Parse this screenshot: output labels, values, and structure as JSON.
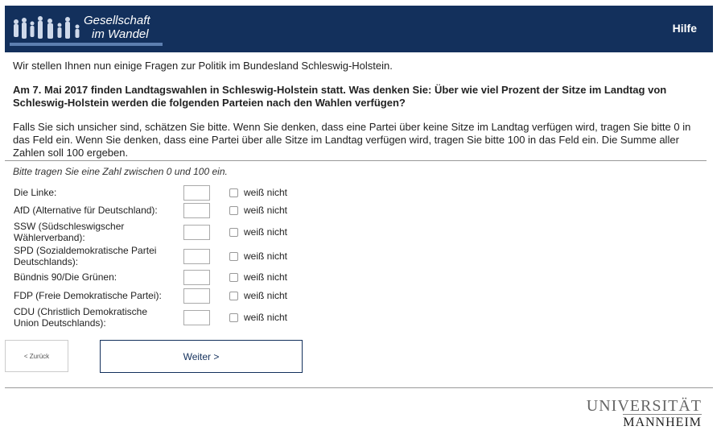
{
  "header": {
    "logo_line1": "Gesellschaft",
    "logo_line2": "im Wandel",
    "help_label": "Hilfe"
  },
  "intro": "Wir stellen Ihnen nun einige Fragen zur Politik im Bundesland Schleswig-Holstein.",
  "question": "Am 7. Mai 2017 finden Landtagswahlen in Schleswig-Holstein statt. Was denken Sie: Über wie viel Prozent der Sitze im Landtag von Schleswig-Holstein werden die folgenden Parteien nach den Wahlen verfügen?",
  "instructions": "Falls Sie sich unsicher sind, schätzen Sie bitte. Wenn Sie denken, dass eine Partei über keine Sitze im Landtag verfügen wird, tragen Sie bitte 0 in das Feld ein. Wenn Sie denken, dass eine Partei über alle Sitze im Landtag verfügen wird, tragen Sie bitte 100 in das Feld ein. Die Summe aller Zahlen soll 100 ergeben.",
  "hint": "Bitte tragen Sie eine Zahl zwischen 0 und 100 ein.",
  "dont_know_label": "weiß nicht",
  "parties": [
    {
      "label": "Die Linke:",
      "value": ""
    },
    {
      "label": "AfD (Alternative für Deutschland):",
      "value": ""
    },
    {
      "label": "SSW (Südschleswigscher Wählerverband):",
      "value": ""
    },
    {
      "label": "SPD (Sozialdemokratische Partei Deutschlands):",
      "value": ""
    },
    {
      "label": "Bündnis 90/Die Grünen:",
      "value": ""
    },
    {
      "label": "FDP (Freie Demokratische Partei):",
      "value": ""
    },
    {
      "label": "CDU (Christlich Demokratische Union Deutschlands):",
      "value": ""
    }
  ],
  "nav": {
    "back_label": "< Zurück",
    "next_label": "Weiter >"
  },
  "footer": {
    "uni_line1": "UNIVERSITÄT",
    "uni_line2": "MANNHEIM"
  },
  "colors": {
    "header_bg": "#13305c"
  }
}
